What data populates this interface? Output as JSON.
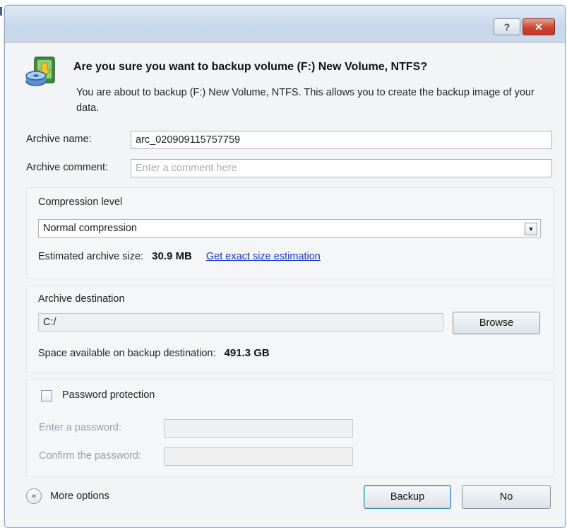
{
  "window": {
    "help_label": "?",
    "close_label": "✕"
  },
  "header": {
    "heading": "Are you sure you want to backup volume (F:) New Volume, NTFS?",
    "description": "You are about to backup (F:) New Volume, NTFS. This allows you to create the backup image of your data."
  },
  "archive": {
    "name_label": "Archive name:",
    "name_value": "arc_020909115757759",
    "comment_label": "Archive comment:",
    "comment_placeholder": "Enter a comment here"
  },
  "compression": {
    "group_title": "Compression level",
    "selected": "Normal compression",
    "estimated_label": "Estimated archive size:",
    "estimated_value": "30.9 MB",
    "exact_link": "Get exact size estimation"
  },
  "destination": {
    "group_title": "Archive destination",
    "path": "C:/",
    "browse_label": "Browse",
    "space_label": "Space available on backup destination:",
    "space_value": "491.3 GB"
  },
  "password": {
    "checkbox_label": "Password protection",
    "checked": false,
    "enter_label": "Enter a password:",
    "confirm_label": "Confirm the password:"
  },
  "footer": {
    "more_options_label": "More options",
    "backup_label": "Backup",
    "no_label": "No"
  },
  "colors": {
    "link": "#1b33c9",
    "close_button": "#c9462f",
    "titlebar": "#c7d7ea"
  }
}
